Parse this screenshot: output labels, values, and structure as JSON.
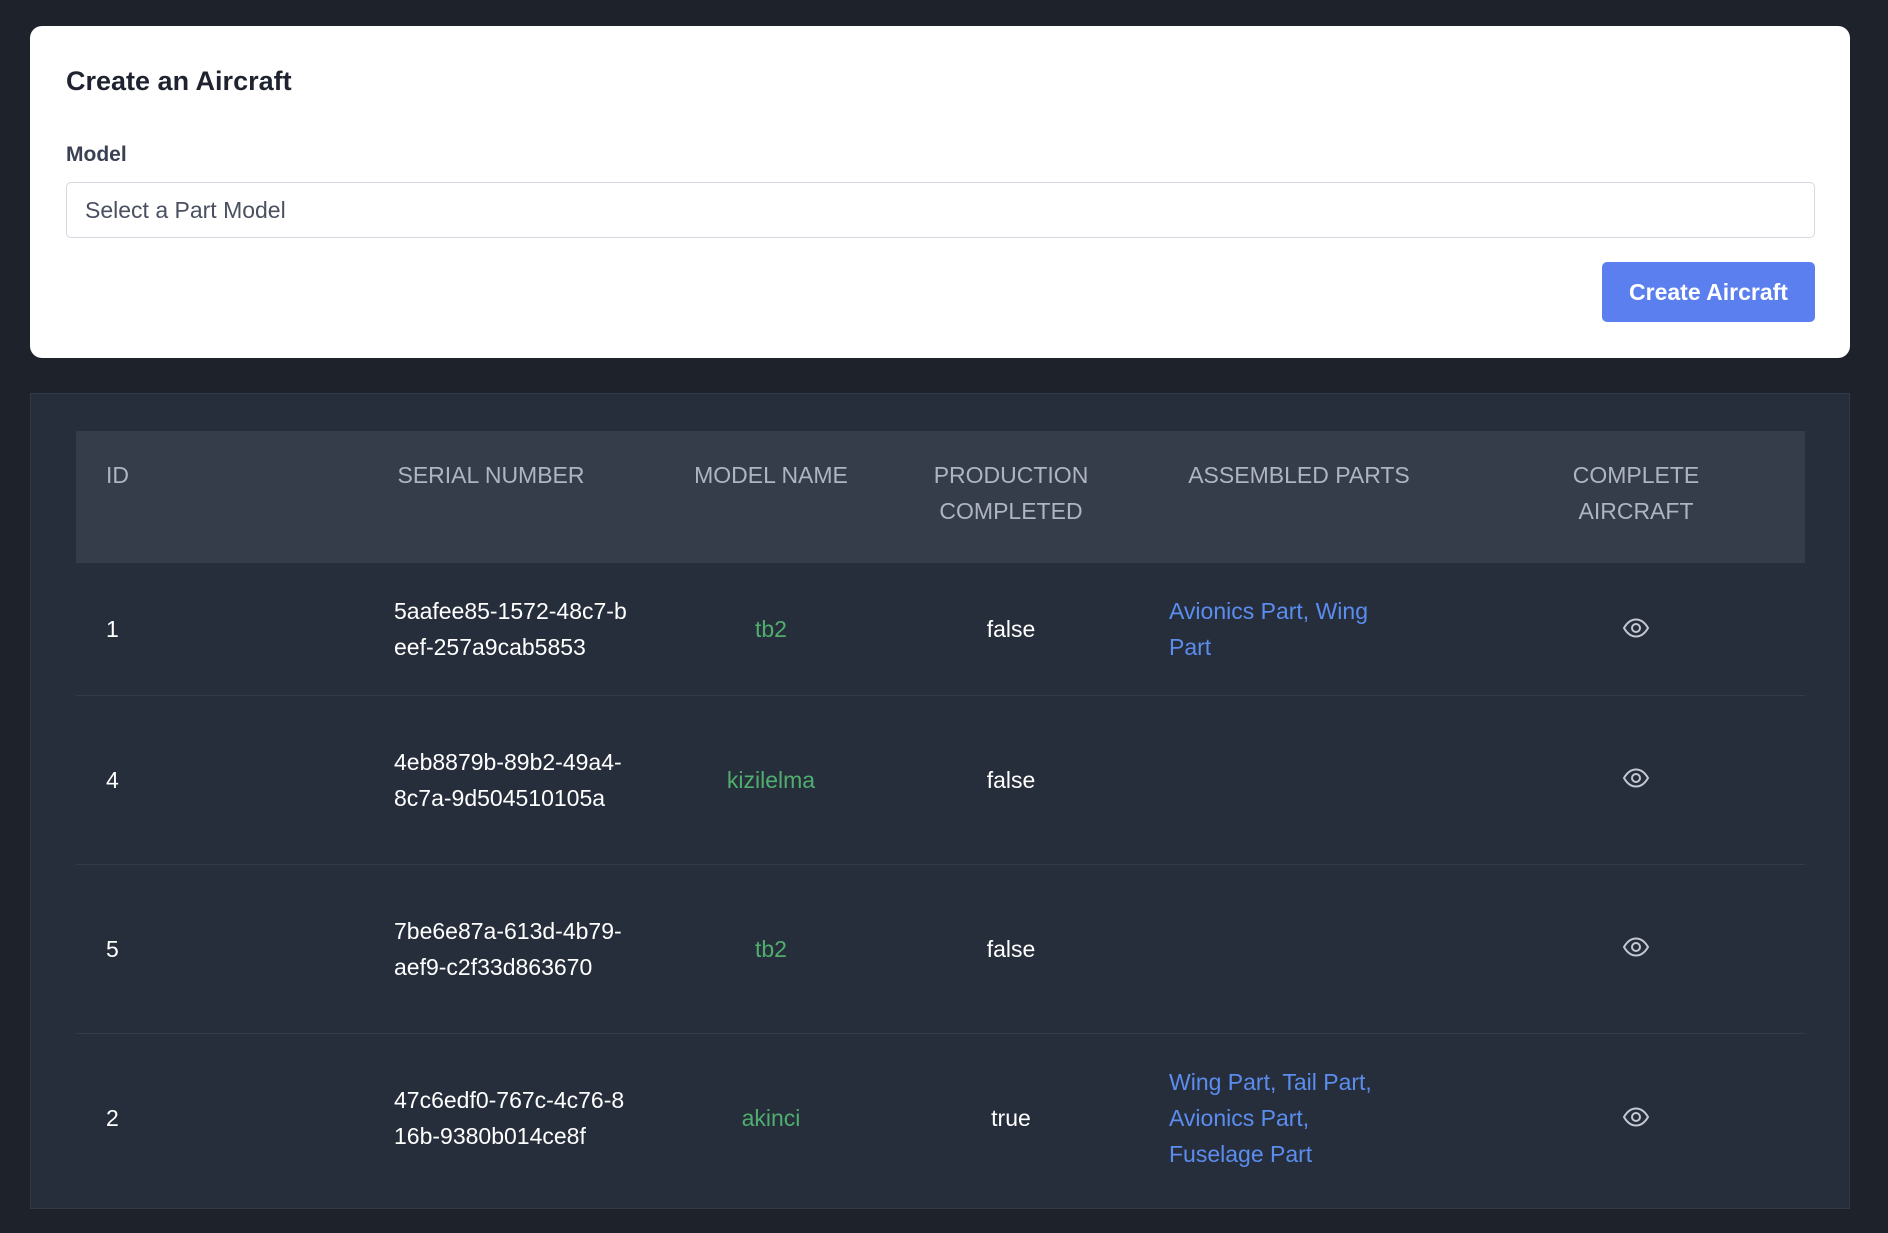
{
  "form": {
    "title": "Create an Aircraft",
    "model_label": "Model",
    "model_placeholder": "Select a Part Model",
    "submit_label": "Create Aircraft"
  },
  "table": {
    "headers": {
      "id": "ID",
      "serial_number": "SERIAL NUMBER",
      "model_name": "MODEL NAME",
      "production_completed": "PRODUCTION COMPLETED",
      "assembled_parts": "ASSEMBLED PARTS",
      "complete_aircraft": "COMPLETE AIRCRAFT"
    },
    "rows": [
      {
        "id": "1",
        "serial": "5aafee85-1572-48c7-beef-257a9cab5853",
        "model": "tb2",
        "completed": "false",
        "parts": "Avionics Part, Wing Part",
        "action_icon": "eye-icon"
      },
      {
        "id": "4",
        "serial": "4eb8879b-89b2-49a4-8c7a-9d504510105a",
        "model": "kizilelma",
        "completed": "false",
        "parts": "",
        "action_icon": "eye-icon"
      },
      {
        "id": "5",
        "serial": "7be6e87a-613d-4b79-aef9-c2f33d863670",
        "model": "tb2",
        "completed": "false",
        "parts": "",
        "action_icon": "eye-icon"
      },
      {
        "id": "2",
        "serial": "47c6edf0-767c-4c76-816b-9380b014ce8f",
        "model": "akinci",
        "completed": "true",
        "parts": "Wing Part, Tail Part, Avionics Part, Fuselage Part",
        "action_icon": "eye-icon"
      }
    ]
  },
  "colors": {
    "page_background": "#1e222b",
    "card_background": "#ffffff",
    "primary_button": "#5b7fee",
    "table_background": "#272e3b",
    "header_background": "#353c4a",
    "model_text": "#4fae6e",
    "parts_link": "#5b8def"
  }
}
